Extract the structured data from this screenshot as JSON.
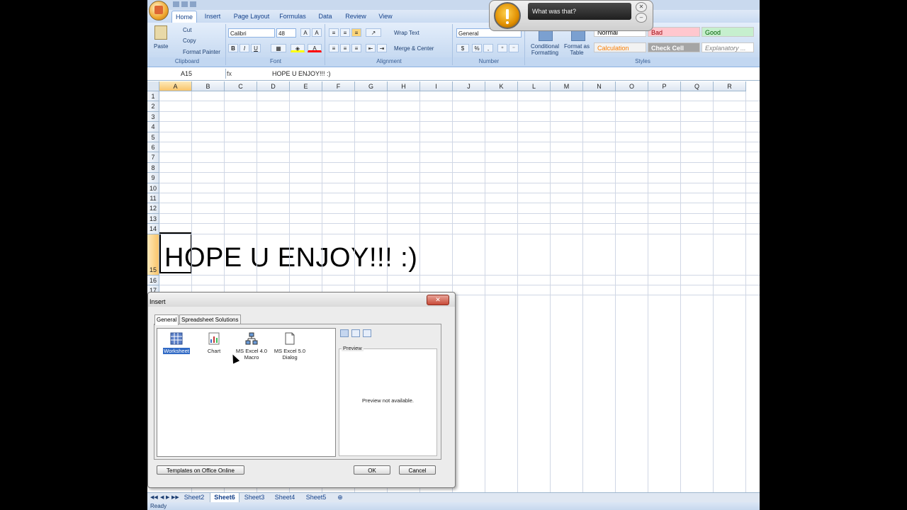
{
  "ribbon": {
    "tabs": [
      "Home",
      "Insert",
      "Page Layout",
      "Formulas",
      "Data",
      "Review",
      "View"
    ],
    "clipboard": {
      "paste": "Paste",
      "cut": "Cut",
      "copy": "Copy",
      "format_painter": "Format Painter",
      "label": "Clipboard"
    },
    "font": {
      "name": "Calibri",
      "size": "48",
      "bold": "B",
      "italic": "I",
      "underline": "U",
      "label": "Font"
    },
    "alignment": {
      "wrap_text": "Wrap Text",
      "merge_center": "Merge & Center",
      "label": "Alignment"
    },
    "number": {
      "format": "General",
      "currency": "$",
      "percent": "%",
      "comma": ",",
      "label": "Number"
    },
    "styles": {
      "conditional": "Conditional Formatting",
      "format_table": "Format as Table",
      "cells": [
        {
          "label": "Normal",
          "bg": "#ffffff",
          "fg": "#000000"
        },
        {
          "label": "Bad",
          "bg": "#ffc7ce",
          "fg": "#9c0006"
        },
        {
          "label": "Good",
          "bg": "#c6efce",
          "fg": "#006100"
        },
        {
          "label": "Calculation",
          "bg": "#f2f2f2",
          "fg": "#fa7d00"
        },
        {
          "label": "Check Cell",
          "bg": "#a5a5a5",
          "fg": "#ffffff"
        },
        {
          "label": "Explanatory ...",
          "bg": "#ffffff",
          "fg": "#7f7f7f"
        }
      ],
      "label": "Styles"
    }
  },
  "formula_bar": {
    "name_box": "A15",
    "fx": "fx",
    "content": "HOPE U ENJOY!!! :)"
  },
  "grid": {
    "columns": [
      "A",
      "B",
      "C",
      "D",
      "E",
      "F",
      "G",
      "H",
      "I",
      "J",
      "K",
      "L",
      "M",
      "N",
      "O",
      "P",
      "Q",
      "R"
    ],
    "rows": [
      "1",
      "2",
      "3",
      "4",
      "5",
      "6",
      "7",
      "8",
      "9",
      "10",
      "11",
      "12",
      "13",
      "14",
      "15",
      "16",
      "17"
    ],
    "cell_a15": "HOPE U ENJOY!!! :)"
  },
  "sheets": [
    "Sheet2",
    "Sheet6",
    "Sheet3",
    "Sheet4",
    "Sheet5"
  ],
  "active_sheet": "Sheet6",
  "status": "Ready",
  "dialog": {
    "title": "Insert",
    "tabs": [
      "General",
      "Spreadsheet Solutions"
    ],
    "items": [
      {
        "label": "Worksheet",
        "icon": "worksheet-icon"
      },
      {
        "label": "Chart",
        "icon": "chart-icon"
      },
      {
        "label": "MS Excel 4.0 Macro",
        "icon": "macro-icon"
      },
      {
        "label": "MS Excel 5.0 Dialog",
        "icon": "dialog-icon"
      }
    ],
    "preview_label": "Preview",
    "preview_message": "Preview not available.",
    "templates_button": "Templates on Office Online",
    "ok": "OK",
    "cancel": "Cancel"
  },
  "popup": {
    "text": "What was that?"
  }
}
